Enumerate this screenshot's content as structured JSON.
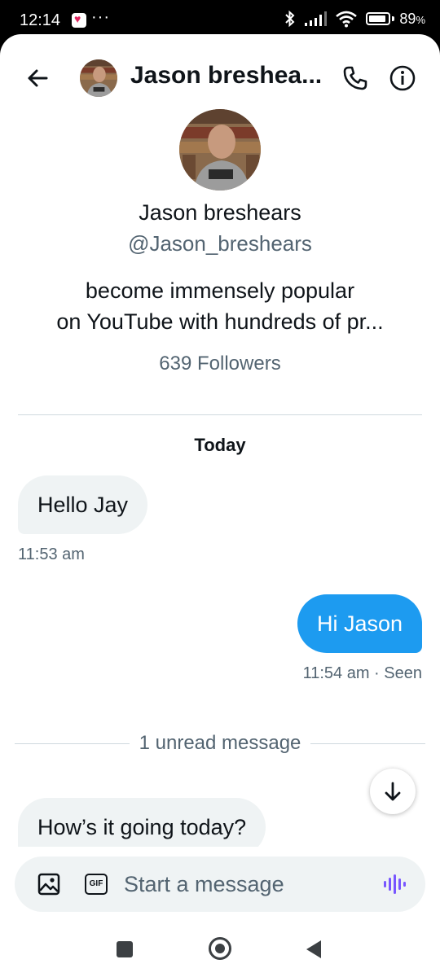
{
  "status_bar": {
    "time": "12:14",
    "more": "···",
    "battery_percent": "89",
    "battery_suffix": "%",
    "battery_level": 0.89
  },
  "header": {
    "name": "Jason breshea...",
    "avatar_icon": "profile-photo"
  },
  "profile": {
    "name": "Jason breshears",
    "handle": "@Jason_breshears",
    "bio_line_1": "become immensely popular",
    "bio_line_2": "on YouTube with hundreds of pr...",
    "followers": "639 Followers"
  },
  "conversation": {
    "date_label": "Today",
    "messages": [
      {
        "direction": "incoming",
        "text": "Hello Jay",
        "time": "11:53 am"
      },
      {
        "direction": "outgoing",
        "text": "Hi Jason",
        "time": "11:54 am",
        "status": "Seen",
        "separator": "·"
      }
    ],
    "unread_label": "1 unread message",
    "unread_messages": [
      {
        "direction": "incoming",
        "text": "How’s it going today?"
      }
    ]
  },
  "composer": {
    "placeholder": "Start a message",
    "gif_label": "GIF"
  },
  "colors": {
    "accent": "#1d9bf0",
    "incoming_bubble": "#eff3f4",
    "secondary_text": "#536471",
    "voice_icon": "#7856ff"
  }
}
